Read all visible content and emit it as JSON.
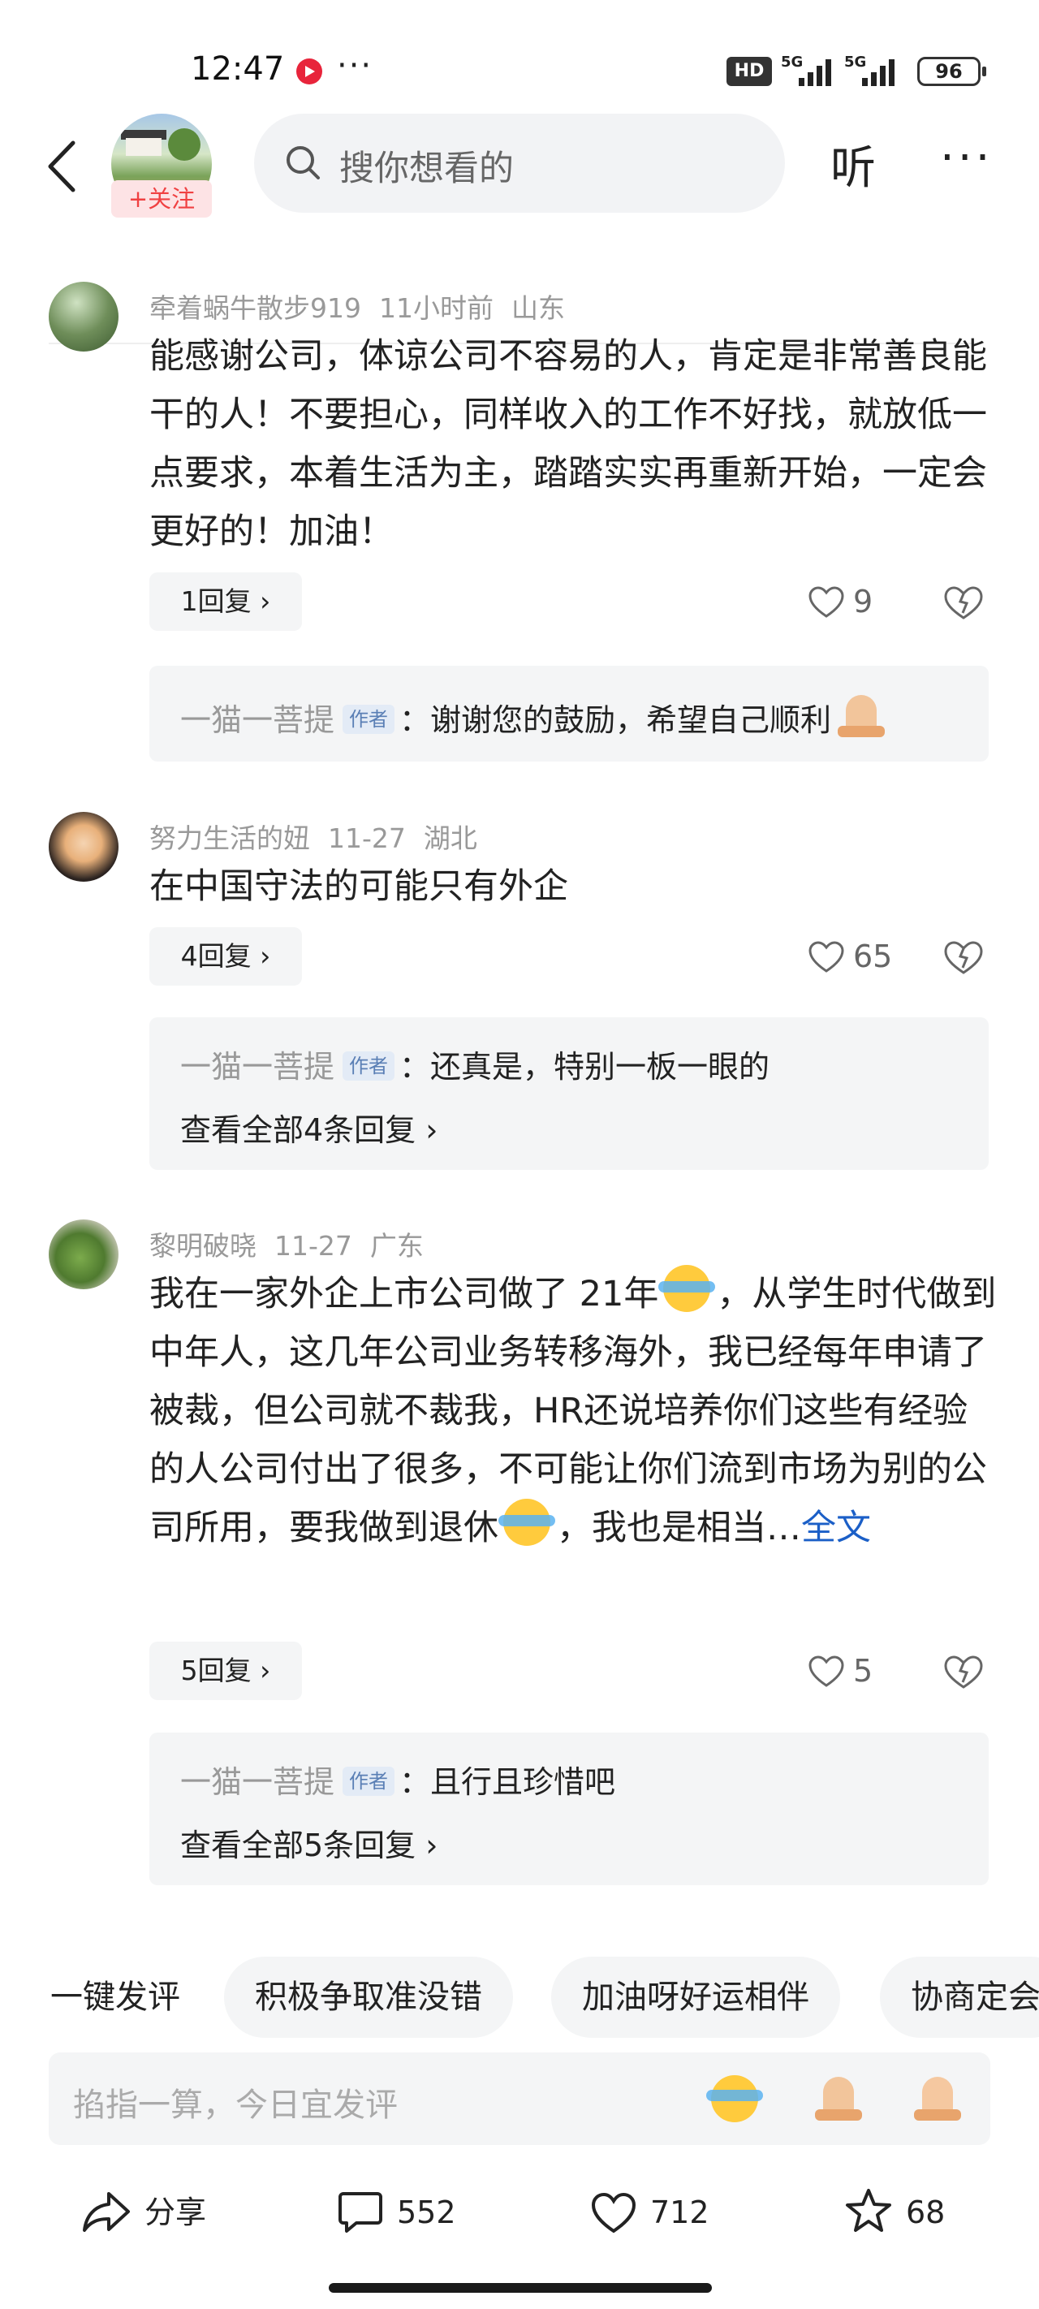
{
  "status_bar": {
    "time": "12:47",
    "hd_label": "HD",
    "signal1_label": "5G",
    "signal2_label": "5G",
    "battery": "96"
  },
  "nav": {
    "follow_label": "+关注",
    "search_placeholder": "搜你想看的",
    "listen_label": "听",
    "more_label": "···"
  },
  "comments": [
    {
      "user": "牵着蜗牛散步919",
      "time": "11小时前",
      "location": "山东",
      "text": "能感谢公司，体谅公司不容易的人，肯定是非常善良能干的人！不要担心，同样收入的工作不好找，就放低一点要求，本着生活为主，踏踏实实再重新开始，一定会更好的！加油！",
      "reply_count_label": "1回复 ›",
      "likes": "9",
      "sub_reply": {
        "author": "一猫一菩提",
        "author_tag": "作者",
        "text": "：谢谢您的鼓励，希望自己顺利"
      }
    },
    {
      "user": "努力生活的妞",
      "time": "11-27",
      "location": "湖北",
      "text": "在中国守法的可能只有外企",
      "reply_count_label": "4回复 ›",
      "likes": "65",
      "sub_reply": {
        "author": "一猫一菩提",
        "author_tag": "作者",
        "text": "：还真是，特别一板一眼的",
        "view_all": "查看全部4条回复 ›"
      }
    },
    {
      "user": "黎明破晓",
      "time": "11-27",
      "location": "广东",
      "text_lines": [
        "我在一家外企上市公司做了 21年",
        "，从学生时代做到中年人，这几年公司业务转移海外，我已经每年申请了被裁，但公司就不裁我，HR还说培养你们这些有经验的人公司付出了很多，不可能让你们流到市场为别的公司所用，要我做到退休",
        "，我也是相当…"
      ],
      "full_text_link": "全文",
      "reply_count_label": "5回复 ›",
      "likes": "5",
      "sub_reply": {
        "author": "一猫一菩提",
        "author_tag": "作者",
        "text": "：且行且珍惜吧",
        "view_all": "查看全部5条回复 ›"
      }
    }
  ],
  "quick_chips": [
    "一键发评",
    "积极争取准没错",
    "加油呀好运相伴",
    "协商定会"
  ],
  "input": {
    "placeholder": "掐指一算，今日宜发评"
  },
  "action_bar": {
    "share_label": "分享",
    "comments_count": "552",
    "likes_count": "712",
    "favorites_count": "68"
  }
}
